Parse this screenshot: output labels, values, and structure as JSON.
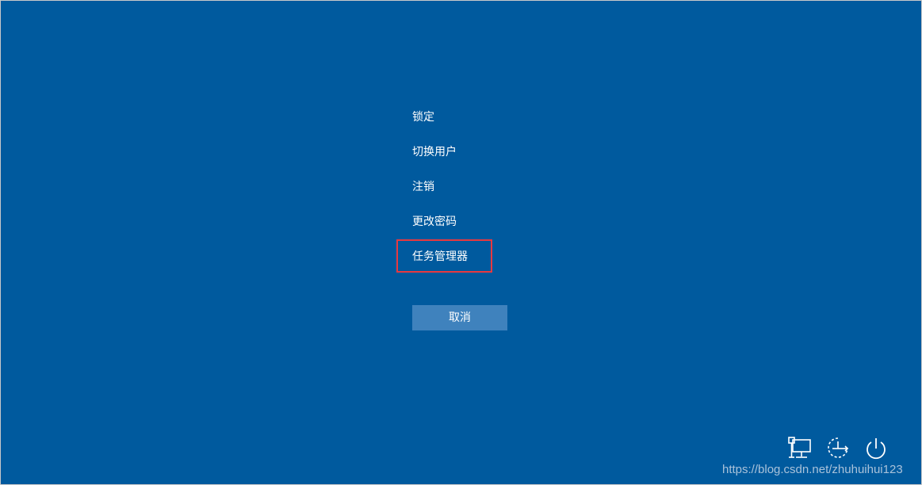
{
  "menu": {
    "items": [
      {
        "label": "锁定"
      },
      {
        "label": "切换用户"
      },
      {
        "label": "注销"
      },
      {
        "label": "更改密码"
      },
      {
        "label": "任务管理器"
      }
    ]
  },
  "cancel": {
    "label": "取消"
  },
  "tray": {
    "icons": [
      "network-icon",
      "ease-of-access-icon",
      "power-icon"
    ]
  },
  "watermark": "https://blog.csdn.net/zhuhuihui123",
  "colors": {
    "background": "#005a9e",
    "button": "#3f82bd",
    "highlight": "#e8393f",
    "text": "#ffffff"
  }
}
